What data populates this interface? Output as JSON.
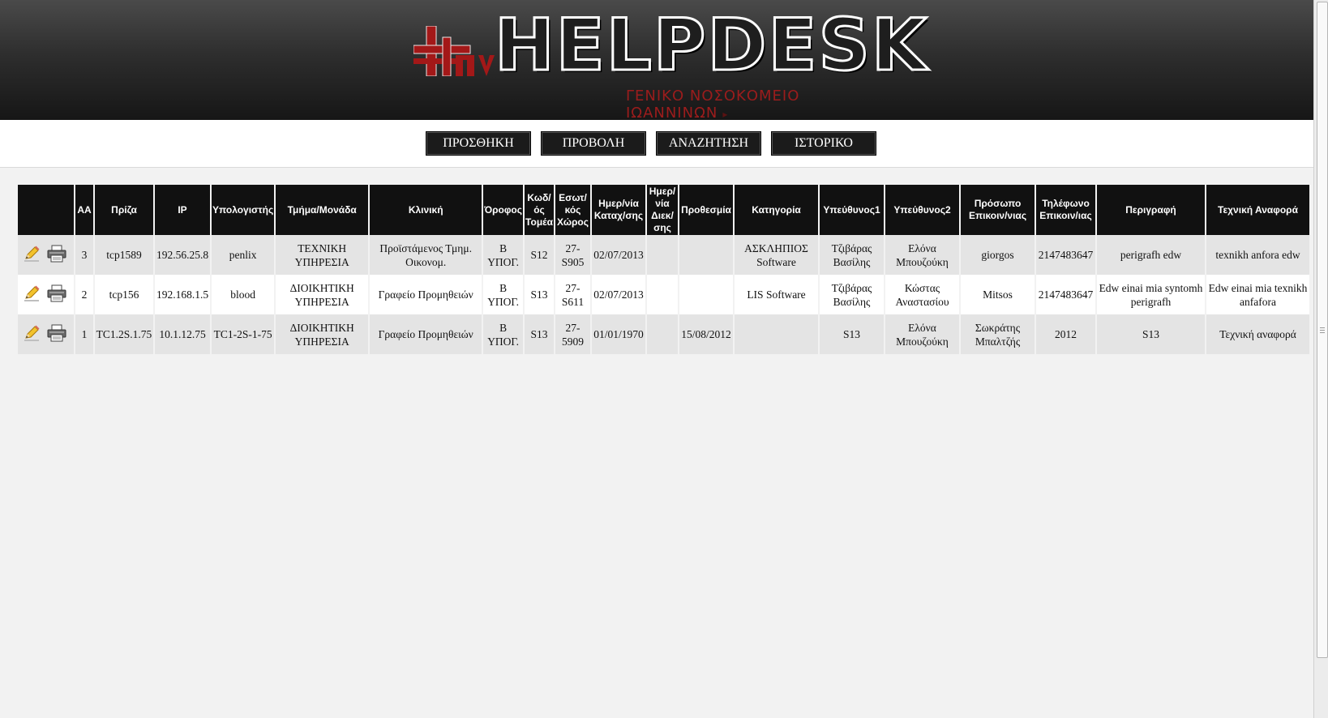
{
  "header": {
    "title": "HELPDESK",
    "subtitle": "ΓΕΝΙΚΟ ΝΟΣΟΚΟΜΕΙΟ ΙΩΑΝΝΙΝΩΝ",
    "brand_color": "#9b1c1c"
  },
  "nav": {
    "add": "ΠΡΟΣΘΗΚΗ",
    "view": "ΠΡΟΒΟΛΗ",
    "search": "ΑΝΑΖΗΤΗΣΗ",
    "history": "ΙΣΤΟΡΙΚΟ"
  },
  "table": {
    "headers": {
      "aa": "ΑΑ",
      "socket": "Πρίζα",
      "ip": "IP",
      "computer": "Υπολογιστής",
      "department": "Τμήμα/Μονάδα",
      "clinic": "Κλινική",
      "floor": "Όροφος",
      "sector_code": "Κωδ/ός Τομέα",
      "internal_room": "Εσωτ/κός Χώρος",
      "reg_date": "Ημερ/νία Καταχ/σης",
      "resolve_date": "Ημερ/νία Διεκ/σης",
      "deadline": "Προθεσμία",
      "category": "Κατηγορία",
      "resp1": "Υπεύθυνος1",
      "resp2": "Υπεύθυνος2",
      "contact": "Πρόσωπο Επικοιν/νιας",
      "phone": "Τηλέφωνο Επικοιν/ιας",
      "description": "Περιγραφή",
      "tech_report": "Τεχνική Αναφορά"
    },
    "rows": [
      {
        "aa": "3",
        "socket": "tcp1589",
        "ip": "192.56.25.8",
        "computer": "penlix",
        "department": "ΤΕΧΝΙΚΗ ΥΠΗΡΕΣΙΑ",
        "clinic": "Προϊστάμενος Τμημ. Οικονομ.",
        "floor": "Β ΥΠΟΓ.",
        "sector_code": "S12",
        "internal_room": "27-S905",
        "reg_date": "02/07/2013",
        "resolve_date": "",
        "deadline": "",
        "category": "ΑΣΚΛΗΠΙΟΣ Software",
        "resp1": "Τζιβάρας Βασίλης",
        "resp2": "Ελόνα Μπουζούκη",
        "contact": "giorgos",
        "phone": "2147483647",
        "description": "perigrafh edw",
        "tech_report": "texnikh anfora edw"
      },
      {
        "aa": "2",
        "socket": "tcp156",
        "ip": "192.168.1.5",
        "computer": "blood",
        "department": "ΔΙΟΙΚΗΤΙΚΗ ΥΠΗΡΕΣΙΑ",
        "clinic": "Γραφείο Προμηθειών",
        "floor": "Β ΥΠΟΓ.",
        "sector_code": "S13",
        "internal_room": "27-S611",
        "reg_date": "02/07/2013",
        "resolve_date": "",
        "deadline": "",
        "category": "LIS Software",
        "resp1": "Τζιβάρας Βασίλης",
        "resp2": "Κώστας Αναστασίου",
        "contact": "Mitsos",
        "phone": "2147483647",
        "description": "Edw einai mia syntomh perigrafh",
        "tech_report": "Edw einai mia texnikh anfafora"
      },
      {
        "aa": "1",
        "socket": "TC1.2S.1.75",
        "ip": "10.1.12.75",
        "computer": "TC1-2S-1-75",
        "department": "ΔΙΟΙΚΗΤΙΚΗ ΥΠΗΡΕΣΙΑ",
        "clinic": "Γραφείο Προμηθειών",
        "floor": "Β ΥΠΟΓ.",
        "sector_code": "S13",
        "internal_room": "27-5909",
        "reg_date": "01/01/1970",
        "resolve_date": "",
        "deadline": "15/08/2012",
        "category": "",
        "resp1": "S13",
        "resp2": "Ελόνα Μπουζούκη",
        "contact": "Σωκράτης Μπαλτζής",
        "phone": "2012",
        "description": "S13",
        "tech_report": "Τεχνική αναφορά"
      }
    ]
  },
  "icons": {
    "edit": "pencil-icon",
    "print": "printer-icon"
  }
}
